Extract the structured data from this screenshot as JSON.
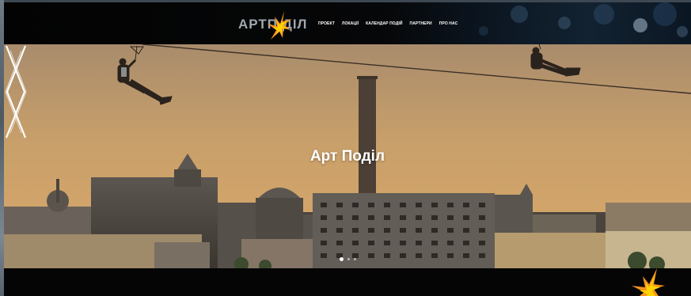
{
  "header": {
    "logo_text": "АРТП  ДІЛ",
    "logo_icon": "starburst-logo-icon"
  },
  "nav": {
    "items": [
      {
        "label": "ПРОЕКТ"
      },
      {
        "label": "ЛОКАЦІЇ"
      },
      {
        "label": "КАЛЕНДАР ПОДІЙ"
      },
      {
        "label": "ПАРТНЕРИ"
      },
      {
        "label": "ПРО НАС"
      }
    ]
  },
  "hero": {
    "title": "Арт Поділ",
    "prev_icon": "chevron-left-icon",
    "next_icon": "chevron-right-icon",
    "slides_count": 3,
    "active_slide": 1
  },
  "colors": {
    "accent_orange": "#f7941d",
    "accent_yellow": "#ffd200",
    "sky": "#c9a06a",
    "header_bg": "#050505"
  }
}
